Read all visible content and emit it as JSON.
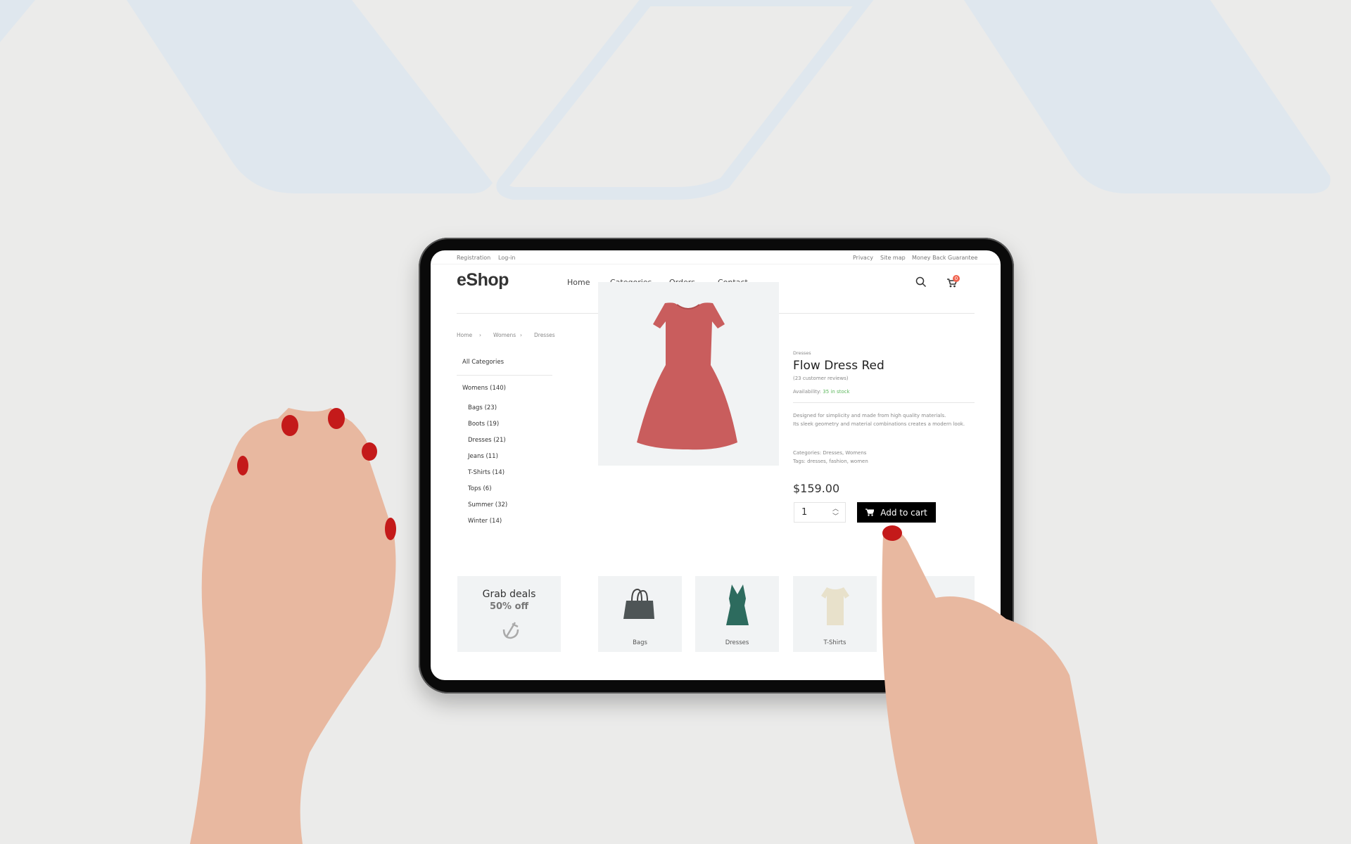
{
  "topbar": {
    "left": [
      "Registration",
      "Log-in"
    ],
    "right": [
      "Privacy",
      "Site map",
      "Money Back Guarantee"
    ]
  },
  "header": {
    "logo": "eShop",
    "nav": [
      "Home",
      "Categories",
      "Orders",
      "Contact"
    ],
    "cart_count": "0"
  },
  "breadcrumb": [
    "Home",
    "Womens",
    "Dresses"
  ],
  "sidebar": {
    "title": "All Categories",
    "parent": "Womens (140)",
    "items": [
      "Bags (23)",
      "Boots (19)",
      "Dresses (21)",
      "Jeans (11)",
      "T-Shirts (14)",
      "Tops (6)",
      "Summer (32)",
      "Winter (14)"
    ]
  },
  "product": {
    "category": "Dresses",
    "title": "Flow Dress Red",
    "reviews": "(23 customer reviews)",
    "availability_label": "Availability:",
    "availability_value": "35 in stock",
    "description": [
      "Designed for simplicity and made from high quality materials.",
      "Its sleek geometry and material combinations creates a modern look."
    ],
    "categories": "Categories: Dresses, Womens",
    "tags": "Tags: dresses, fashion, women",
    "price": "$159.00",
    "quantity": "1",
    "add_to_cart": "Add to cart",
    "color": "#c95d5d"
  },
  "promo": {
    "title": "Grab deals",
    "subtitle": "50% off"
  },
  "tiles": [
    "Bags",
    "Dresses",
    "T-Shirts"
  ],
  "colors": {
    "stock": "#5cb85c",
    "badge": "#f0634f",
    "button": "#000000"
  }
}
